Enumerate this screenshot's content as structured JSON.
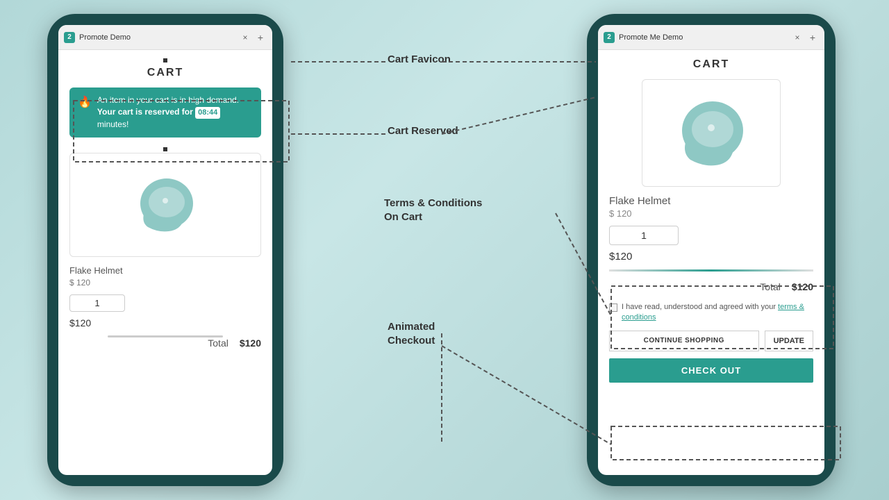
{
  "app": {
    "title": "Promote Me Demo",
    "favicon_number": "2",
    "close_symbol": "×",
    "new_tab_symbol": "+"
  },
  "left_phone": {
    "browser": {
      "title": "Promote Demo",
      "tab_number": "2"
    },
    "cart": {
      "heading": "CART",
      "notification": {
        "text": "An item in your cart is in high demand.",
        "bold_text": "Your cart is reserved for",
        "timer": "08:44",
        "timer_suffix": "minutes!"
      },
      "product": {
        "name": "Flake Helmet",
        "price_label": "$ 120",
        "quantity": "1",
        "total": "$120"
      },
      "total_label": "Total",
      "total_amount": "$120"
    }
  },
  "right_phone": {
    "browser": {
      "title": "Promote Me Demo",
      "tab_number": "2"
    },
    "cart": {
      "heading": "CART",
      "product": {
        "name": "Flake Helmet",
        "price_label": "$ 120",
        "quantity": "1",
        "total": "$120"
      },
      "total_label": "Total",
      "total_amount": "$120",
      "terms_text": "I have read, understood and agreed with your",
      "terms_link": "terms & conditions",
      "buttons": {
        "continue": "CONTINUE SHOPPING",
        "update": "UPDATE",
        "checkout": "CHECK OUT"
      }
    }
  },
  "diagram": {
    "labels": {
      "cart_favicon": "Cart Favicon",
      "cart_reserved": "Cart Reserved",
      "terms_conditions": "Terms & Conditions\nOn Cart",
      "animated_checkout": "Animated\nCheckout"
    }
  }
}
